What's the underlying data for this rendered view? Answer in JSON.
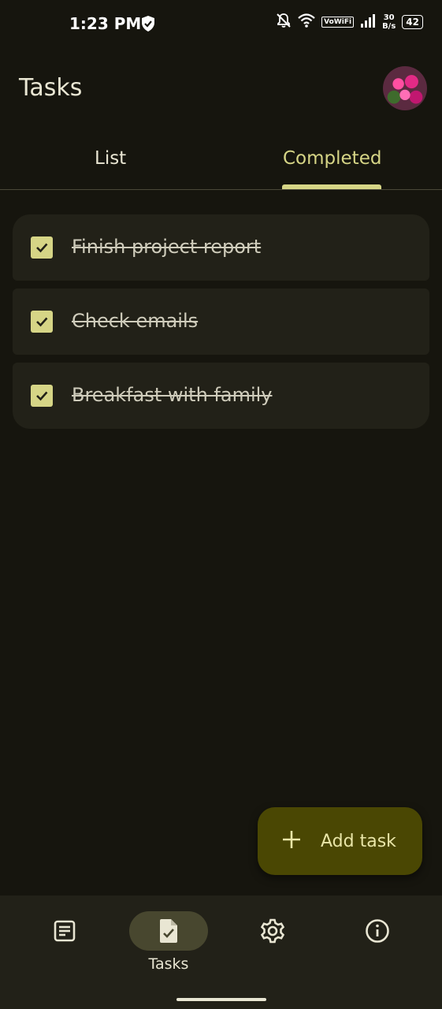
{
  "status_bar": {
    "time": "1:23 PM",
    "network_type": "VoWiFi",
    "speed_value": "30",
    "speed_unit": "B/s",
    "battery": "42"
  },
  "header": {
    "title": "Tasks"
  },
  "tabs": [
    {
      "label": "List",
      "selected": false
    },
    {
      "label": "Completed",
      "selected": true
    }
  ],
  "tasks": [
    {
      "label": "Finish project report",
      "completed": true
    },
    {
      "label": "Check emails",
      "completed": true
    },
    {
      "label": "Breakfast with family",
      "completed": true
    }
  ],
  "fab": {
    "label": "Add task",
    "icon": "plus-icon"
  },
  "bottom_nav": [
    {
      "icon": "notes-icon",
      "label": ""
    },
    {
      "icon": "task-check-icon",
      "label": "Tasks",
      "active": true
    },
    {
      "icon": "settings-gear-icon",
      "label": ""
    },
    {
      "icon": "info-icon",
      "label": ""
    }
  ],
  "colors": {
    "background": "#16150e",
    "accent": "#d6d586",
    "card": "#222118",
    "fab": "#4a4703"
  }
}
